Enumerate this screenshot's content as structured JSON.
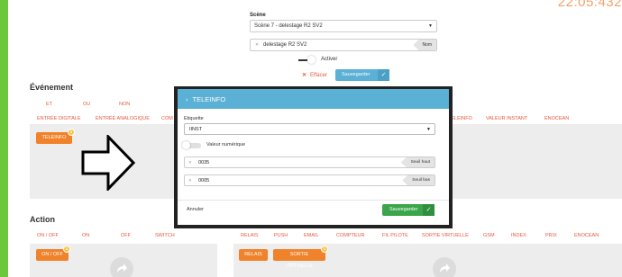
{
  "clock": "22:05:432",
  "scene": {
    "label": "Scène",
    "selected": "Scène 7 - delestage R2 SV2",
    "name_value": "delestage R2 SV2",
    "name_tag": "Nom",
    "actif_label": "Activer",
    "effacer_label": "Effacer",
    "save_label": "Sauvegarder"
  },
  "evenement": {
    "title": "Événement",
    "logic_tabs": [
      "ET",
      "OU",
      "NON"
    ],
    "tabs": [
      "ENTRÉE DIGITALE",
      "ENTRÉE ANALOGIQUE",
      "COM",
      "TELEINFO",
      "VALEUR INSTANT",
      "ENOCEAN"
    ],
    "chip": {
      "label": "TELEINFO",
      "count": "1"
    }
  },
  "action": {
    "title": "Action",
    "tabs_left": [
      "ON / OFF",
      "ON",
      "OFF",
      "SWITCH"
    ],
    "tabs_right": [
      "RELAIS",
      "PUSH",
      "EMAIL",
      "COMPTEUR",
      "FIL PILOTE",
      "SORTIE VIRTUELLE",
      "GSM",
      "INDEX",
      "PRIX",
      "ENOCEAN"
    ],
    "chip_left": {
      "label": "ON / OFF",
      "count": "1"
    },
    "chip_relais": "RELAIS",
    "chip_sortie": {
      "label": "SORTIE VIRTUELLE",
      "count": "1"
    }
  },
  "modal": {
    "title": "TELEINFO",
    "etiquette_label": "Etiquette",
    "etiquette_value": "IINST",
    "toggle_label": "Valeur numérique",
    "seuil_haut_value": "0035",
    "seuil_haut_tag": "Seuil haut",
    "seuil_bas_value": "0005",
    "seuil_bas_tag": "Seuil bas",
    "cancel_label": "Annuler",
    "save_label": "Sauvegarder"
  },
  "colors": {
    "accent_orange": "#f0822a",
    "tab_red": "#e9573f",
    "header_blue": "#5ab0d5",
    "save_green": "#3aa54a",
    "sidebar_green": "#6bc83b"
  }
}
